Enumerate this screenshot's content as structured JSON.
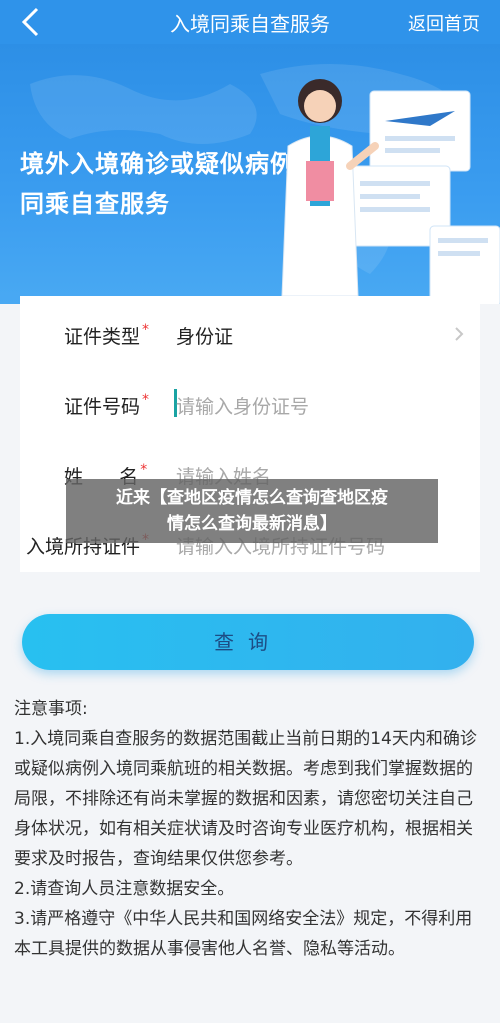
{
  "header": {
    "title": "入境同乘自查服务",
    "home_link": "返回首页"
  },
  "banner": {
    "line1": "境外入境确诊或疑似病例",
    "line2": "同乘自查服务"
  },
  "form": {
    "id_type": {
      "label": "证件类型",
      "value": "身份证"
    },
    "id_number": {
      "label": "证件号码",
      "placeholder": "请输入身份证号"
    },
    "name": {
      "label": "姓      名",
      "placeholder": "请输入姓名"
    },
    "entry_doc": {
      "label": "入境所持证件",
      "placeholder": "请输入入境所持证件号码"
    },
    "required_mark": "*"
  },
  "actions": {
    "query_label": "查询"
  },
  "notes": {
    "title": "注意事项:",
    "items": [
      "1.入境同乘自查服务的数据范围截止当前日期的14天内和确诊或疑似病例入境同乘航班的相关数据。考虑到我们掌握数据的局限，不排除还有尚未掌握的数据和因素，请您密切关注自己身体状况，如有相关症状请及时咨询专业医疗机构，根据相关要求及时报告，查询结果仅供您参考。",
      "2.请查询人员注意数据安全。",
      "3.请严格遵守《中华人民共和国网络安全法》规定，不得利用本工具提供的数据从事侵害他人名誉、隐私等活动。"
    ]
  },
  "overlay": {
    "line1": "近来【查地区疫情怎么查询查地区疫",
    "line2": "情怎么查询最新消息】"
  },
  "colors": {
    "header": "#2f93ea",
    "button": "#28c0f0",
    "required": "#e33333"
  }
}
